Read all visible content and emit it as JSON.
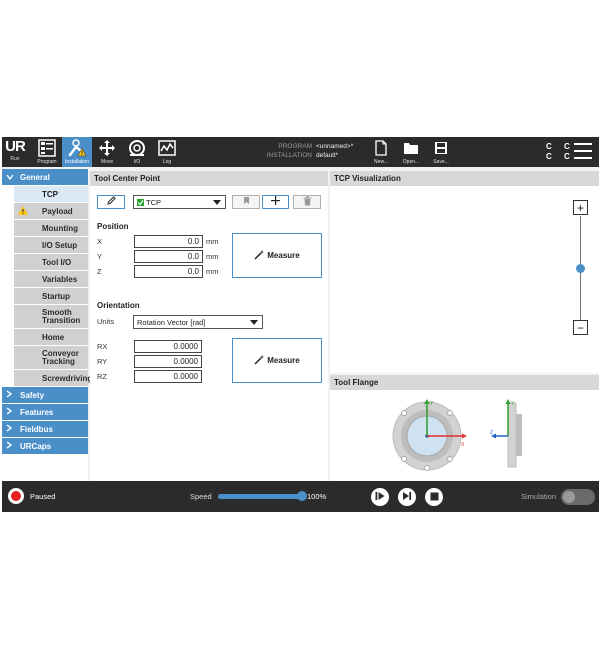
{
  "toolbar": {
    "run_label": "Run",
    "program_label": "Program",
    "installation_label": "Installation",
    "move_label": "Move",
    "io_label": "I/O",
    "log_label": "Log",
    "program_key": "PROGRAM",
    "program_value": "<unnamed>*",
    "installation_key": "INSTALLATION",
    "installation_value": "default*",
    "new_label": "New...",
    "open_label": "Open...",
    "save_label": "Save...",
    "cc_text": "C C C C"
  },
  "sidebar": {
    "general": "General",
    "items": [
      {
        "label": "TCP"
      },
      {
        "label": "Payload"
      },
      {
        "label": "Mounting"
      },
      {
        "label": "I/O Setup"
      },
      {
        "label": "Tool I/O"
      },
      {
        "label": "Variables"
      },
      {
        "label": "Startup"
      },
      {
        "label": "Smooth Transition"
      },
      {
        "label": "Home"
      },
      {
        "label": "Conveyor Tracking"
      },
      {
        "label": "Screwdriving"
      }
    ],
    "sections": [
      {
        "label": "Safety"
      },
      {
        "label": "Features"
      },
      {
        "label": "Fieldbus"
      },
      {
        "label": "URCaps"
      }
    ]
  },
  "tcp": {
    "title": "Tool Center Point",
    "selected_tcp": "TCP",
    "position_label": "Position",
    "x_label": "X",
    "x_value": "0.0",
    "y_label": "Y",
    "y_value": "0.0",
    "z_label": "Z",
    "z_value": "0.0",
    "unit_mm": "mm",
    "measure_label": "Measure",
    "orientation_label": "Orientation",
    "units_label": "Units",
    "units_value": "Rotation Vector [rad]",
    "rx_label": "RX",
    "rx_value": "0.0000",
    "ry_label": "RY",
    "ry_value": "0.0000",
    "rz_label": "RZ",
    "rz_value": "0.0000"
  },
  "visualization": {
    "title": "TCP Visualization",
    "zoom_in": "+",
    "zoom_out": "−",
    "zoom_fraction": 0.5
  },
  "flange": {
    "title": "Tool Flange",
    "y_axis": "Y",
    "x_axis": "X",
    "z_axis": "Z"
  },
  "bottom": {
    "status": "Paused",
    "speed_label": "Speed",
    "speed_value": "100%",
    "speed_fraction": 1.0,
    "simulation_label": "Simulation"
  },
  "colors": {
    "accent": "#4b8fc9",
    "bar": "#2b2b2b",
    "stop": "#e02020",
    "axis_x": "#e03030",
    "axis_y": "#2ca02c",
    "axis_z": "#2060c0"
  }
}
